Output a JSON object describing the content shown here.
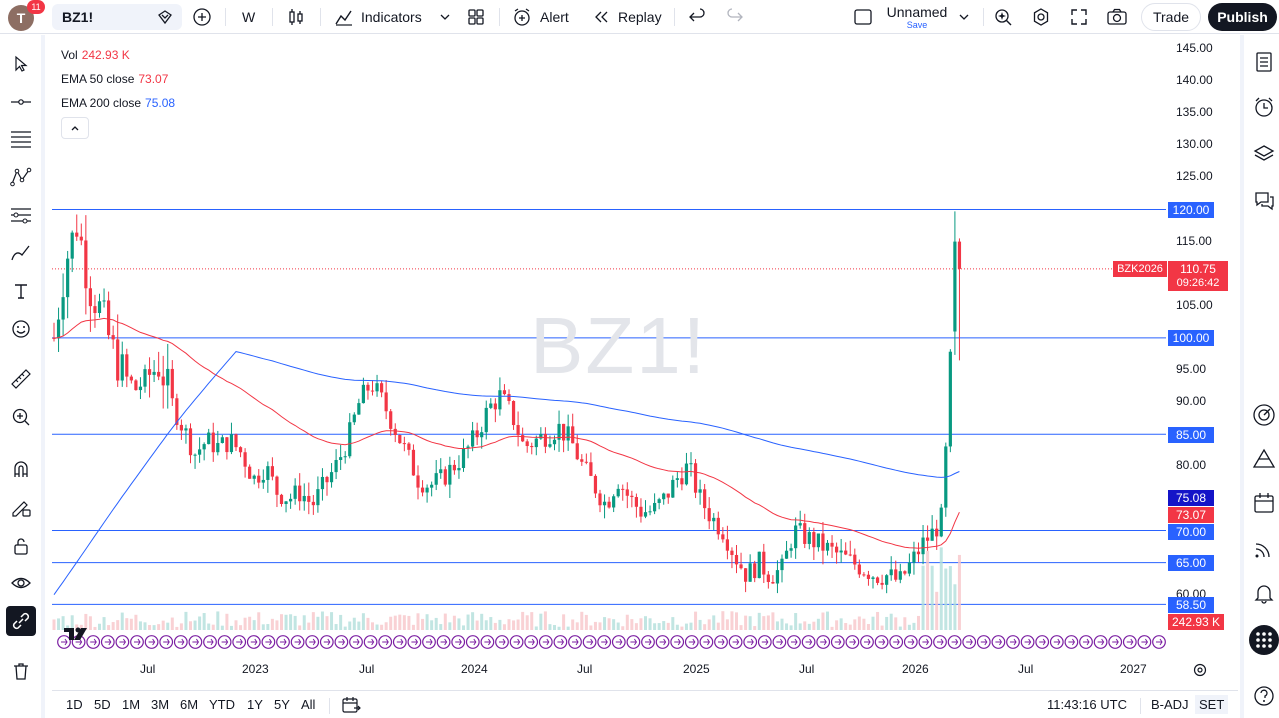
{
  "topbar": {
    "avatar_letter": "T",
    "notifications": "11",
    "symbol": "BZ1!",
    "interval": "W",
    "indicators_label": "Indicators",
    "alert_label": "Alert",
    "replay_label": "Replay",
    "layout_name": "Unnamed",
    "layout_save": "Save",
    "trade_label": "Trade",
    "publish_label": "Publish"
  },
  "legend": {
    "vol_label": "Vol",
    "vol_value": "242.93 K",
    "ema50_label": "EMA 50 close",
    "ema50_value": "73.07",
    "ema200_label": "EMA 200 close",
    "ema200_value": "75.08"
  },
  "watermark": "BZ1!",
  "price_axis": {
    "ticks": [
      "145.00",
      "140.00",
      "135.00",
      "130.00",
      "125.00",
      "120.00",
      "115.00",
      "110.00",
      "105.00",
      "100.00",
      "95.00",
      "90.00",
      "85.00",
      "80.00",
      "75.00",
      "70.00",
      "65.00",
      "60.00"
    ],
    "labels": {
      "h120": "120.00",
      "h100": "100.00",
      "h85": "85.00",
      "ema200": "75.08",
      "ema50": "73.07",
      "h70": "70.00",
      "h65": "65.00",
      "h58": "58.50",
      "vol": "242.93 K",
      "last_symbol": "BZK2026",
      "last_price": "110.75",
      "countdown": "09:26:42"
    }
  },
  "time_axis": [
    "Jul",
    "2023",
    "Jul",
    "2024",
    "Jul",
    "2025",
    "Jul",
    "2026",
    "Jul",
    "2027"
  ],
  "bottombar": {
    "ranges": [
      "1D",
      "5D",
      "1M",
      "3M",
      "6M",
      "YTD",
      "1Y",
      "5Y",
      "All"
    ],
    "clock": "11:43:16 UTC",
    "adj": "B-ADJ",
    "session": "SET"
  },
  "colors": {
    "up": "#089981",
    "down": "#f23645",
    "ema50": "#f23645",
    "ema200": "#2962ff",
    "hline": "#2962ff"
  },
  "chart_data": {
    "type": "candlestick",
    "symbol": "BZ1!",
    "interval": "W",
    "horizontal_levels": [
      120,
      100,
      85,
      70,
      65,
      58.5
    ],
    "last_price": 110.75,
    "ema50_last": 73.07,
    "ema200_last": 75.08,
    "ylim": [
      57,
      148
    ],
    "close_series": [
      [
        2022.35,
        100
      ],
      [
        2022.4,
        112
      ],
      [
        2022.45,
        118
      ],
      [
        2022.5,
        108
      ],
      [
        2022.55,
        104
      ],
      [
        2022.6,
        98
      ],
      [
        2022.65,
        94
      ],
      [
        2022.7,
        92
      ],
      [
        2022.75,
        94
      ],
      [
        2022.8,
        96
      ],
      [
        2022.85,
        90
      ],
      [
        2022.9,
        86
      ],
      [
        2022.95,
        82
      ],
      [
        2023.0,
        84
      ],
      [
        2023.05,
        83
      ],
      [
        2023.1,
        84
      ],
      [
        2023.15,
        82
      ],
      [
        2023.2,
        78
      ],
      [
        2023.25,
        80
      ],
      [
        2023.3,
        76
      ],
      [
        2023.35,
        75
      ],
      [
        2023.4,
        76
      ],
      [
        2023.45,
        74
      ],
      [
        2023.5,
        77
      ],
      [
        2023.55,
        80
      ],
      [
        2023.6,
        84
      ],
      [
        2023.65,
        90
      ],
      [
        2023.7,
        93
      ],
      [
        2023.75,
        90
      ],
      [
        2023.8,
        86
      ],
      [
        2023.85,
        82
      ],
      [
        2023.9,
        78
      ],
      [
        2023.95,
        77
      ],
      [
        2024.0,
        78
      ],
      [
        2024.05,
        80
      ],
      [
        2024.1,
        82
      ],
      [
        2024.15,
        85
      ],
      [
        2024.2,
        89
      ],
      [
        2024.25,
        91
      ],
      [
        2024.3,
        88
      ],
      [
        2024.35,
        83
      ],
      [
        2024.4,
        84
      ],
      [
        2024.45,
        85
      ],
      [
        2024.5,
        86
      ],
      [
        2024.55,
        84
      ],
      [
        2024.6,
        80
      ],
      [
        2024.65,
        77
      ],
      [
        2024.7,
        74
      ],
      [
        2024.75,
        78
      ],
      [
        2024.8,
        75
      ],
      [
        2024.85,
        73
      ],
      [
        2024.9,
        73
      ],
      [
        2024.95,
        75
      ],
      [
        2025.0,
        78
      ],
      [
        2025.05,
        80
      ],
      [
        2025.1,
        75
      ],
      [
        2025.15,
        72
      ],
      [
        2025.2,
        70
      ],
      [
        2025.25,
        66
      ],
      [
        2025.3,
        63
      ],
      [
        2025.35,
        65
      ],
      [
        2025.4,
        63
      ],
      [
        2025.45,
        64
      ],
      [
        2025.5,
        70
      ],
      [
        2025.55,
        69
      ],
      [
        2025.6,
        68
      ],
      [
        2025.65,
        67
      ],
      [
        2025.7,
        66
      ],
      [
        2025.75,
        65
      ],
      [
        2025.8,
        64
      ],
      [
        2025.85,
        63
      ],
      [
        2025.9,
        63
      ],
      [
        2025.95,
        62
      ],
      [
        2026.0,
        65
      ],
      [
        2026.05,
        68
      ],
      [
        2026.1,
        70
      ],
      [
        2026.13,
        72
      ],
      [
        2026.16,
        90
      ],
      [
        2026.18,
        106
      ],
      [
        2026.2,
        112
      ],
      [
        2026.22,
        110.75
      ]
    ]
  }
}
